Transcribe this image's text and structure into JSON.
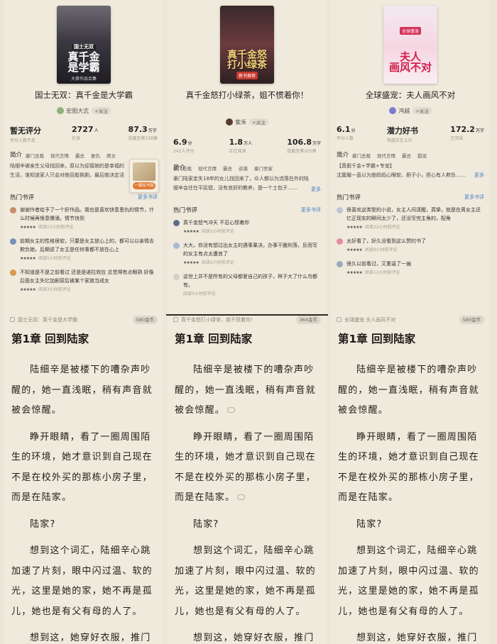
{
  "colors": {
    "background": "#ece6d8",
    "link": "#4b7ec4",
    "text": "#1f1c17"
  },
  "common": {
    "intro_label": "简介",
    "hot_reviews_label": "热门书评",
    "more_reviews": "更多书评",
    "more": "更多",
    "stars": "★★★★★",
    "follow": "+关注",
    "chapter_title": "第1章 回到陆家",
    "paragraphs": [
      "陆细辛是被楼下的嘈杂声吵醒的，她一直浅眠，稍有声音就被会惊醒。",
      "睁开眼睛，看了一圈周围陌生的环境，她才意识到自己现在不是在校外买的那栋小房子里，而是在陆家。",
      "陆家?",
      "想到这个词汇，陆细辛心跳加速了片刻，眼中闪过温、软的光，这里是她的家，她不再是孤儿，她也是有父有母的人了。",
      "想到这，她穿好衣服，推门下"
    ]
  },
  "books": [
    {
      "cover": {
        "lines": [
          "国士无双",
          "真千金",
          "是学霸"
        ],
        "sub": "大茶作品合集"
      },
      "title": "国士无双：真千金是大学霸",
      "author": "宏图大志",
      "stats": [
        {
          "value": "暂无评分",
          "unit": "",
          "label": "评分人数不足"
        },
        {
          "value": "2727",
          "unit": "人",
          "label": "在读"
        },
        {
          "value": "87.3",
          "unit": "万字",
          "label": "连载至第158章"
        }
      ],
      "tags": [
        "豪门总裁",
        "现代言情",
        "霸总",
        "复仇",
        "爽文"
      ],
      "intro": "陆细辛被亲生父母找回来，原以为迎接她的是幸福的生活，谁知道家人只会对她百般挑剔，最后她决定活出自己的样子……好的亲情。",
      "overlay_button": "一键加书架",
      "reviews": [
        {
          "text": "谢谢作者给予了一个好作品。我也是喜欢快意恩仇的情节，什么时候再恨意爆涌，情节快到",
          "meta": "阅读15小时前评论"
        },
        {
          "text": "前期女主的性格很软，只要是女主放心上的，都可以以亲情去欺负她，后期说了女主是任何事都不放在心上",
          "meta": "阅读5小时前评论"
        },
        {
          "text": "不知道是不是之前看过 还是是递拉效应 总觉得有点眼熟 好像后面女主失忆加剧容后被某个家族当成女",
          "meta": "阅读3小时前评论"
        }
      ],
      "bar_left": "国士无双：真千金是大学霸",
      "bar_price": "580金币"
    },
    {
      "cover": {
        "lines": [
          "真千金怒",
          "打小绿茶"
        ],
        "badge": "新书推荐",
        "sub": ""
      },
      "title": "真千金怒打小绿茶，姐不惯着你！",
      "author": "紫禾",
      "stats": [
        {
          "value": "6.9",
          "unit": "分",
          "label": "242人评分"
        },
        {
          "value": "1.8",
          "unit": "万人",
          "label": "正在阅读"
        },
        {
          "value": "106.8",
          "unit": "万字",
          "label": "连载至第205章"
        }
      ],
      "tags": [
        "豪门总裁",
        "现代言情",
        "霸总",
        "逆袭",
        "豪门世家"
      ],
      "intro": "豪门陆家走失18年的女儿找回来了，众人都以为流落在外的陆细辛会往在平民窟，没有良好的教养，是一个土包子……",
      "reviews": [
        {
          "text": "真千金怒气冲天 不忍心惯着你",
          "meta": "阅读2小时前评论"
        },
        {
          "text": "大大，你没有想过出女主的遇事果决，办事干脆利落，反而写的女主有点太遭良了",
          "meta": "阅读5小时前评论"
        },
        {
          "text": "这世上并不是所有的父母都爱自己的孩子，林子大了什么鸟都有。",
          "meta": "阅读3小时前评论"
        }
      ],
      "bar_left": "真千金怒打小绿茶，姐不惯着你!",
      "bar_price": "364金币"
    },
    {
      "cover": {
        "lines": [
          "夫人",
          "画风不对"
        ],
        "badge": "全球盛宠",
        "sub": ""
      },
      "title": "全球盛宠：夫人画风不对",
      "author": "鸿越",
      "stats": [
        {
          "value": "6.1",
          "unit": "分",
          "label": "评分人数"
        },
        {
          "value": "潜力好书",
          "unit": "",
          "label": "热度正在上升"
        },
        {
          "value": "172.2",
          "unit": "万字",
          "label": "已完结"
        }
      ],
      "tags": [
        "豪门总裁",
        "现代言情",
        "霸总",
        "甜宠"
      ],
      "intro_line1": "【真假千金+学霸+专宠】",
      "intro_line2": "沈嘉耀一直以为她妈妈心眼软、胆子小，担心有人欺负……",
      "reviews": [
        {
          "text": "很喜欢这类型的小说，女主人间清醒，真挚，就是在男女主还忆正现实的瞬间太少了，还没写完主角的，配角",
          "meta": "阅读22小时前评论"
        },
        {
          "text": "太好看了，好久没看到这么赞的书了",
          "meta": "阅读9小时前评论"
        },
        {
          "text": "很久以前看过，又重温了一遍",
          "meta": "阅读12小时前评论"
        }
      ],
      "bar_left": "全球盛宠  夫人画风不对",
      "bar_price": "580金币"
    }
  ]
}
